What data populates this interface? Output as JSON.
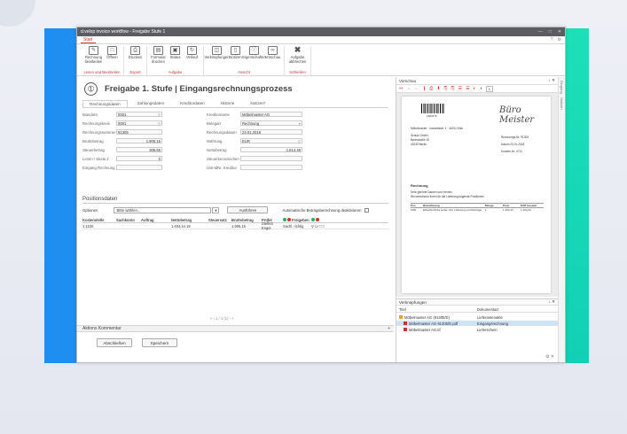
{
  "window": {
    "title": "d.velop invoice workflow - Freigabe Stufe 1",
    "min": "—",
    "max": "□",
    "close": "✕"
  },
  "tabs": {
    "start": "Start",
    "help": "?",
    "settings": "⚙"
  },
  "ribbon": {
    "groups": [
      {
        "label": "Lesen und Bearbeiten",
        "buttons": [
          "Rechnung bearbeiten",
          "Öffnen"
        ]
      },
      {
        "label": "Export",
        "buttons": [
          "Drucken"
        ]
      },
      {
        "label": "Aufgabe",
        "buttons": [
          "Formular drucken",
          "Status",
          "Verlauf"
        ]
      },
      {
        "label": "Ansicht",
        "buttons": [
          "Verknüpfungen",
          "Notizen",
          "Eigenschaften",
          "Vorschau"
        ]
      },
      {
        "label": "Schließen",
        "buttons": [
          "Aufgabe abbrechen"
        ]
      }
    ]
  },
  "header": {
    "logo": "➀",
    "title": "Freigabe 1. Stufe | Eingangsrechnungsprozess"
  },
  "form_tabs": [
    "Rechnungsdaten",
    "Zahlungsdaten",
    "Kreditordaten",
    "Historie",
    "Notizen*"
  ],
  "fields_left": [
    {
      "label": "Mandant",
      "value": "0001"
    },
    {
      "label": "Rechnungskreis",
      "value": "0001"
    },
    {
      "label": "Rechnungsnummer",
      "value": "91305"
    },
    {
      "label": "Bruttobetrag",
      "value": "1.905,15"
    },
    {
      "label": "Steuerbetrag",
      "value": "306,65"
    },
    {
      "label": "Lesen / Skala 2",
      "value": "0"
    },
    {
      "label": "Eingang Rechnung",
      "value": ""
    }
  ],
  "fields_right": [
    {
      "label": "Kreditorname",
      "value": "Möbelmaster AG"
    },
    {
      "label": "Belegart",
      "value": "Rechnung"
    },
    {
      "label": "Rechnungsdatum",
      "value": "23.01.2018"
    },
    {
      "label": "Währung",
      "value": "EUR"
    },
    {
      "label": "Nettobetrag",
      "value": "1.614,48"
    },
    {
      "label": "Steuerkennzeichen",
      "value": ""
    },
    {
      "label": "USt-IdNr. Kreditor",
      "value": ""
    }
  ],
  "positions": {
    "title": "Positionsdaten",
    "options_label": "Optionen",
    "select_value": "Bitte wählen...",
    "execute": "Ausführen",
    "auto_label": "Automatische Betragsberechnung deaktivieren",
    "columns": [
      "Kostenstelle",
      "Sachkonto",
      "Auftrag",
      "Nettobetrag",
      "Steuersatz",
      "Bruttobetrag",
      "Prüfer",
      "Freigeben",
      ""
    ],
    "rows": [
      {
        "kst": "1 1100",
        "sk": "",
        "auftrag": "",
        "netto": "1.404,44  19",
        "steuer": "",
        "brutto": "1.905,15",
        "pruefer": "Steffen Engel",
        "freigeben": "Sachl. richtig"
      }
    ]
  },
  "pager": "« ‹ 1 / 1 (1) › »",
  "comments": {
    "title": "Aktions Kommentar",
    "expand": "+"
  },
  "actions": {
    "complete": "Abschließen",
    "save": "Speichern"
  },
  "viewer": {
    "title": "Vorschau",
    "controls": "↓ ✕",
    "toolbar": [
      "↤",
      "→",
      "←",
      "❙",
      "⎙",
      "⬇",
      "⎘",
      "⎘",
      "☰",
      "☰",
      "◐",
      "◑"
    ],
    "zoom": "1",
    "sidestrip": [
      "Eingang",
      "Notizen"
    ],
    "doc": {
      "barcode": "1983476",
      "company": "Büro Meister",
      "sender": "Möbelmaster · Industriestr. 1 · 40211 Köln",
      "recipient_lines": [
        "Schulz GmbH",
        "Bauhstraße 15",
        "40235 Berlin"
      ],
      "meta_lines": [
        "Rechnungs-Nr. 91305",
        "Datum 23.01.2018",
        "Kunden-Nr. 4711"
      ],
      "heading": "Rechnung",
      "subject": "Sehr geehrte Damen und Herren,",
      "body": "Wir berechnen Ihnen für die Lieferung folgende Positionen:",
      "table_header": [
        "Pos.",
        "Bezeichnung",
        "Menge",
        "Preis",
        "EUR Gesamt"
      ],
      "table_row": [
        "1001",
        "Ecksofa Nizza Leder, inkl. Lieferung und Montage",
        "1",
        "1.404,44",
        "1.404,44"
      ]
    }
  },
  "links": {
    "title": "Verknüpfungen",
    "controls": "↓ ✕",
    "col_title": "Titel",
    "col_type": "Dokumentart",
    "items": [
      {
        "title": "Möbelmaster AG (91305/D)",
        "type": "Lieferantenakte"
      },
      {
        "title": "Möbelmaster AG 91305/D.pdf",
        "type": "Eingangsrechnung"
      },
      {
        "title": "Möbelmaster AG.tif",
        "type": "Lieferschein"
      }
    ],
    "footer": "⚙ ✕"
  },
  "colors": {
    "accent": "#c0392b",
    "left_band": "#1e8ff0",
    "right_band": "#1ce0b8",
    "titlebar": "#5b5d62"
  }
}
